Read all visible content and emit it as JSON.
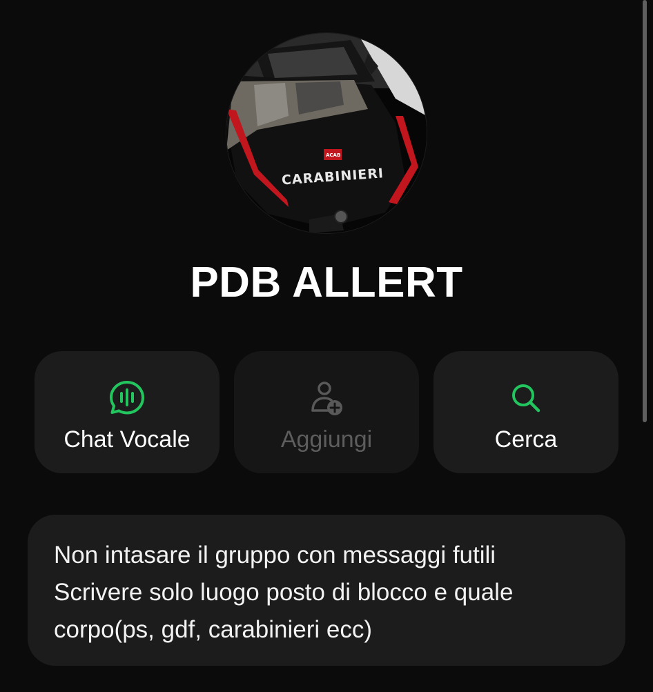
{
  "group": {
    "name": "PDB ALLERT"
  },
  "avatar": {
    "icon": "group-avatar",
    "text": "CARABINIERI",
    "badge": "ACAB"
  },
  "actions": [
    {
      "label": "Chat Vocale",
      "icon": "voice-chat-icon",
      "enabled": true
    },
    {
      "label": "Aggiungi",
      "icon": "add-member-icon",
      "enabled": false
    },
    {
      "label": "Cerca",
      "icon": "search-icon",
      "enabled": true
    }
  ],
  "description": {
    "lines": [
      "Non intasare il gruppo con messaggi futili",
      "Scrivere solo luogo posto di blocco e quale",
      "corpo(ps, gdf, carabinieri ecc)"
    ]
  },
  "colors": {
    "background": "#0b0b0b",
    "card": "#1c1c1c",
    "accent": "#22c55e",
    "disabled": "#5d5d5d"
  }
}
